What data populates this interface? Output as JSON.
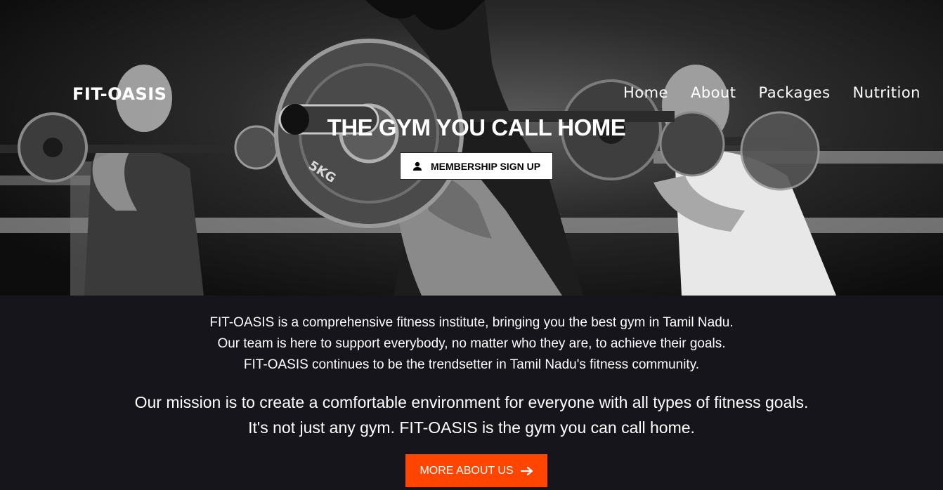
{
  "header": {
    "brand": "FIT-OASIS",
    "nav": [
      "Home",
      "About",
      "Packages",
      "Nutrition"
    ]
  },
  "hero": {
    "headline": "THE GYM YOU CALL HOME",
    "signup_label": "MEMBERSHIP SIGN UP",
    "signup_icon": "user-icon",
    "plate_label": "5KG"
  },
  "about": {
    "intro_lines": [
      "FIT-OASIS is a comprehensive fitness institute, bringing you the best gym in Tamil Nadu.",
      "Our team is here to support everybody, no matter who they are, to achieve their goals.",
      "FIT-OASIS continues to be the trendsetter in Tamil Nadu's fitness community."
    ],
    "mission_lines": [
      "Our mission is to create a comfortable environment for everyone with all types of fitness goals.",
      "It's not just any gym. FIT-OASIS is the gym you can call home."
    ],
    "button_label": "MORE ABOUT US",
    "button_icon": "arrow-right-icon"
  },
  "colors": {
    "accent": "#ff4500",
    "section_bg": "#16151c",
    "text": "#ffffff"
  }
}
